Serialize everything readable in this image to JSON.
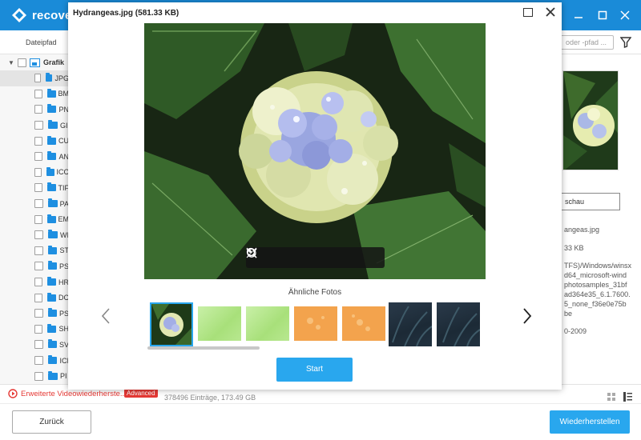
{
  "app": {
    "name": "recove",
    "brand_color": "#1a8bd8",
    "accent_color": "#29a7ee",
    "window_controls": [
      "minimize-icon",
      "maximize-icon",
      "close-icon"
    ]
  },
  "toolbar": {
    "column_header": "Dateipfad",
    "search_placeholder": "oder -pfad ...",
    "filter_icon": "filter-icon"
  },
  "sidebar": {
    "root_label": "Grafik",
    "items": [
      {
        "label": "JPG",
        "selected": true
      },
      {
        "label": "BM",
        "selected": false
      },
      {
        "label": "PN",
        "selected": false
      },
      {
        "label": "GI",
        "selected": false
      },
      {
        "label": "CU",
        "selected": false
      },
      {
        "label": "AN",
        "selected": false
      },
      {
        "label": "ICC",
        "selected": false
      },
      {
        "label": "TIF",
        "selected": false
      },
      {
        "label": "PA",
        "selected": false
      },
      {
        "label": "EM",
        "selected": false
      },
      {
        "label": "WI",
        "selected": false
      },
      {
        "label": "ST",
        "selected": false
      },
      {
        "label": "PS",
        "selected": false
      },
      {
        "label": "HR",
        "selected": false
      },
      {
        "label": "DC",
        "selected": false
      },
      {
        "label": "PS",
        "selected": false
      },
      {
        "label": "SH",
        "selected": false
      },
      {
        "label": "SV",
        "selected": false
      },
      {
        "label": "ICI",
        "selected": false
      },
      {
        "label": "PI",
        "selected": false
      }
    ]
  },
  "right_panel": {
    "preview_button": "schau",
    "file_name": "angeas.jpg",
    "file_size": "33 KB",
    "path_lines": [
      "TFS)/Windows/winsx",
      "d64_microsoft-wind",
      "photosamples_31bf",
      "ad364e35_6.1.7600.",
      "5_none_f36e0e75b",
      "be"
    ],
    "date": "0-2009"
  },
  "status": {
    "link": "Erweiterte Videowiederherste...",
    "badge": "Advanced",
    "entries": "378496 Einträge, 173.49  GB"
  },
  "footer": {
    "back": "Zurück",
    "restore": "Wiederherstellen"
  },
  "modal": {
    "title": "Hydrangeas.jpg (581.33  KB)",
    "similar_label": "Ähnliche Fotos",
    "start": "Start",
    "controls": [
      "fit-screen-icon",
      "zoom-in-icon",
      "zoom-out-icon",
      "rotate-left-icon",
      "rotate-right-icon"
    ],
    "thumbnails": [
      "hydrangea",
      "green",
      "green",
      "orange",
      "orange",
      "dark",
      "dark"
    ]
  }
}
